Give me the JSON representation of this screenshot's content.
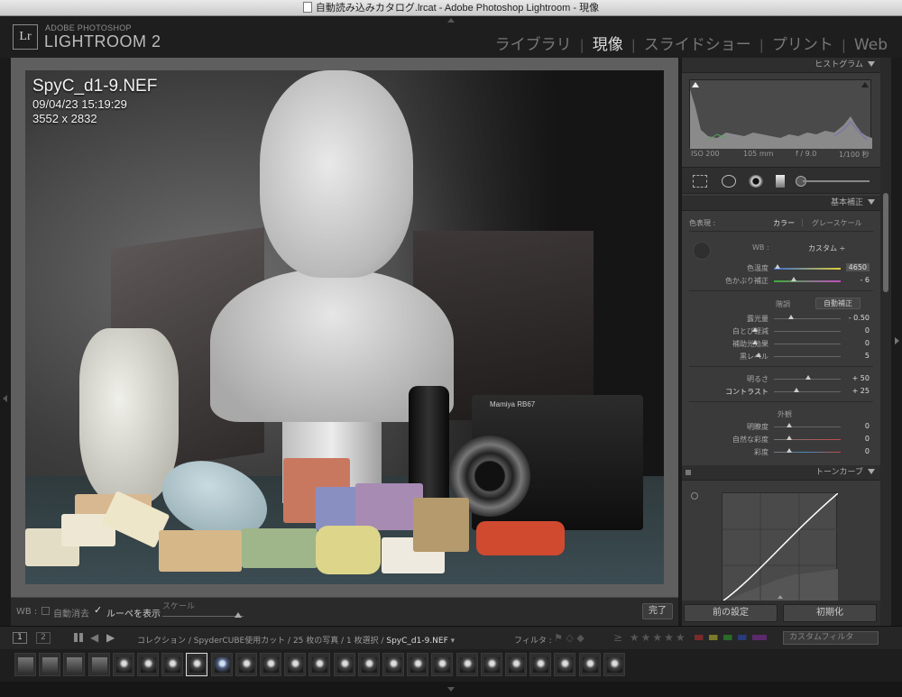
{
  "window": {
    "title": "自動読み込みカタログ.lrcat - Adobe Photoshop Lightroom - 現像"
  },
  "logo": {
    "mark": "Lr",
    "line1": "ADOBE PHOTOSHOP",
    "line2": "LIGHTROOM 2"
  },
  "modules": [
    {
      "label": "ライブラリ",
      "active": false
    },
    {
      "label": "現像",
      "active": true
    },
    {
      "label": "スライドショー",
      "active": false
    },
    {
      "label": "プリント",
      "active": false
    },
    {
      "label": "Web",
      "active": false
    }
  ],
  "photo_info": {
    "filename": "SpyC_d1-9.NEF",
    "datetime": "09/04/23 15:19:29",
    "dimensions": "3552 x 2832",
    "camera_brand": "Mamiya RB67"
  },
  "toolbar": {
    "wb_label": "WB :",
    "auto_dismiss": "自動消去",
    "auto_dismiss_checked": false,
    "show_loupe": "ルーペを表示",
    "show_loupe_checked": true,
    "scale_label": "スケール",
    "done_button": "完了"
  },
  "histogram": {
    "title": "ヒストグラム",
    "iso": "ISO 200",
    "focal": "105 mm",
    "aperture": "f / 9.0",
    "shutter": "1/100 秒"
  },
  "basic": {
    "title": "基本補正",
    "treatment_label": "色表現 :",
    "treatment_color": "カラー",
    "treatment_gray": "グレースケール",
    "wb_label": "WB :",
    "wb_value": "カスタム ÷",
    "temp": {
      "label": "色温度",
      "value": "4650",
      "pos": 0.38
    },
    "tint": {
      "label": "色かぶり補正",
      "value": "- 6",
      "pos": 0.6
    },
    "tone_label": "階調",
    "auto_tone": "自動補正",
    "exposure": {
      "label": "露光量",
      "value": "- 0.50",
      "pos": 0.55
    },
    "recovery": {
      "label": "白とび軽減",
      "value": "0",
      "pos": 0.02
    },
    "fill": {
      "label": "補助光効果",
      "value": "0",
      "pos": 0.02
    },
    "blacks": {
      "label": "黒レベル",
      "value": "5",
      "pos": 0.06
    },
    "brightness": {
      "label": "明るさ",
      "value": "+ 50",
      "pos": 0.78
    },
    "contrast": {
      "label": "コントラスト",
      "value": "+ 25",
      "pos": 0.62
    },
    "presence_label": "外観",
    "clarity": {
      "label": "明瞭度",
      "value": "0",
      "pos": 0.5
    },
    "vibrance": {
      "label": "自然な彩度",
      "value": "0",
      "pos": 0.5
    },
    "saturation": {
      "label": "彩度",
      "value": "0",
      "pos": 0.5
    }
  },
  "tone_curve": {
    "title": "トーンカーブ"
  },
  "panel_buttons": {
    "previous": "前の設定",
    "reset": "初期化"
  },
  "filmstrip_bar": {
    "page1": "1",
    "page2": "2",
    "breadcrumb_prefix": "コレクション / SpyderCUBE使用カット / 25 枚の写真 / 1 枚選択 /",
    "breadcrumb_current": "SpyC_d1-9.NEF",
    "filter_label": "フィルタ :",
    "custom_filter": "カスタムフィルタ"
  },
  "filmstrip_count": 25,
  "colors": {
    "accent": "#dddddd",
    "panel_bg": "#3a3a3a",
    "canvas_bg": "#5f5f5f"
  }
}
